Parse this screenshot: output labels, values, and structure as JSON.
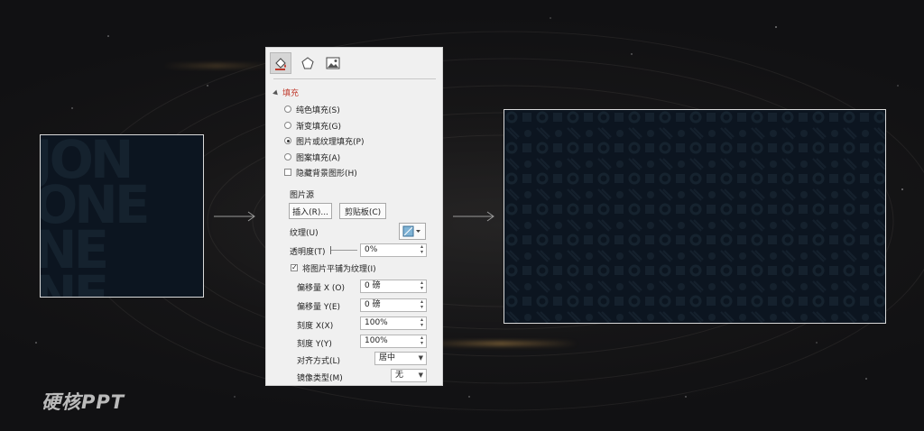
{
  "watermark": "硬核PPT",
  "source_tile": {
    "logo_lines": [
      "JON",
      "ONE",
      "NE",
      "NE"
    ]
  },
  "panel": {
    "tabs": [
      {
        "name": "fill-line-tab",
        "icon": "paint-bucket-icon"
      },
      {
        "name": "effects-tab",
        "icon": "pentagon-icon"
      },
      {
        "name": "picture-tab",
        "icon": "picture-icon"
      }
    ],
    "section_title": "填充",
    "fill_options": [
      {
        "label": "纯色填充(S)",
        "selected": false
      },
      {
        "label": "渐变填充(G)",
        "selected": false
      },
      {
        "label": "图片或纹理填充(P)",
        "selected": true
      },
      {
        "label": "图案填充(A)",
        "selected": false
      }
    ],
    "hide_background_label": "隐藏背景图形(H)",
    "picture_source_label": "图片源",
    "insert_button": "插入(R)...",
    "clipboard_button": "剪贴板(C)",
    "texture_label": "纹理(U)",
    "transparency_label": "透明度(T)",
    "transparency_value": "0%",
    "tile_label": "将图片平铺为纹理(I)",
    "tile_checked": true,
    "offset_x_label": "偏移量 X (O)",
    "offset_x_value": "0 磅",
    "offset_y_label": "偏移量 Y(E)",
    "offset_y_value": "0 磅",
    "scale_x_label": "刻度 X(X)",
    "scale_x_value": "100%",
    "scale_y_label": "刻度 Y(Y)",
    "scale_y_value": "100%",
    "align_label": "对齐方式(L)",
    "align_value": "居中",
    "mirror_label": "镜像类型(M)",
    "mirror_value": "无"
  },
  "colors": {
    "tile_bg": "#0c1520",
    "accent_red": "#c0392b",
    "panel_bg": "#f0f0f0"
  }
}
